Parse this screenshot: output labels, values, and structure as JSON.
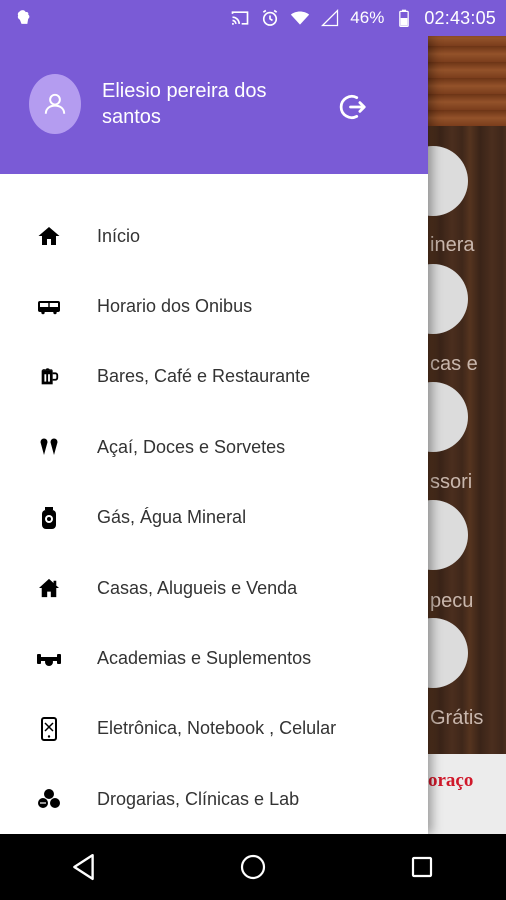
{
  "status_bar": {
    "battery_percent": "46%",
    "time": "02:43:05"
  },
  "drawer": {
    "user_name": "Eliesio pereira dos santos",
    "menu": [
      {
        "label": "Início",
        "icon": "home-icon"
      },
      {
        "label": "Horario dos Onibus",
        "icon": "bus-icon"
      },
      {
        "label": "Bares, Café e Restaurante",
        "icon": "mug-icon"
      },
      {
        "label": "Açaí, Doces e Sorvetes",
        "icon": "icecream-icon"
      },
      {
        "label": "Gás, Água Mineral",
        "icon": "gas-bottle-icon"
      },
      {
        "label": "Casas, Alugueis e Venda",
        "icon": "house-icon"
      },
      {
        "label": "Academias e Suplementos",
        "icon": "dumbbell-icon"
      },
      {
        "label": "Eletrônica, Notebook , Celular",
        "icon": "phone-icon"
      },
      {
        "label": "Drogarias, Clínicas e Lab",
        "icon": "pills-icon"
      }
    ]
  },
  "background_app": {
    "labels": [
      "inera",
      "cas e",
      "ssori",
      "pecu",
      "Grátis"
    ],
    "banner_text": "oraço"
  }
}
